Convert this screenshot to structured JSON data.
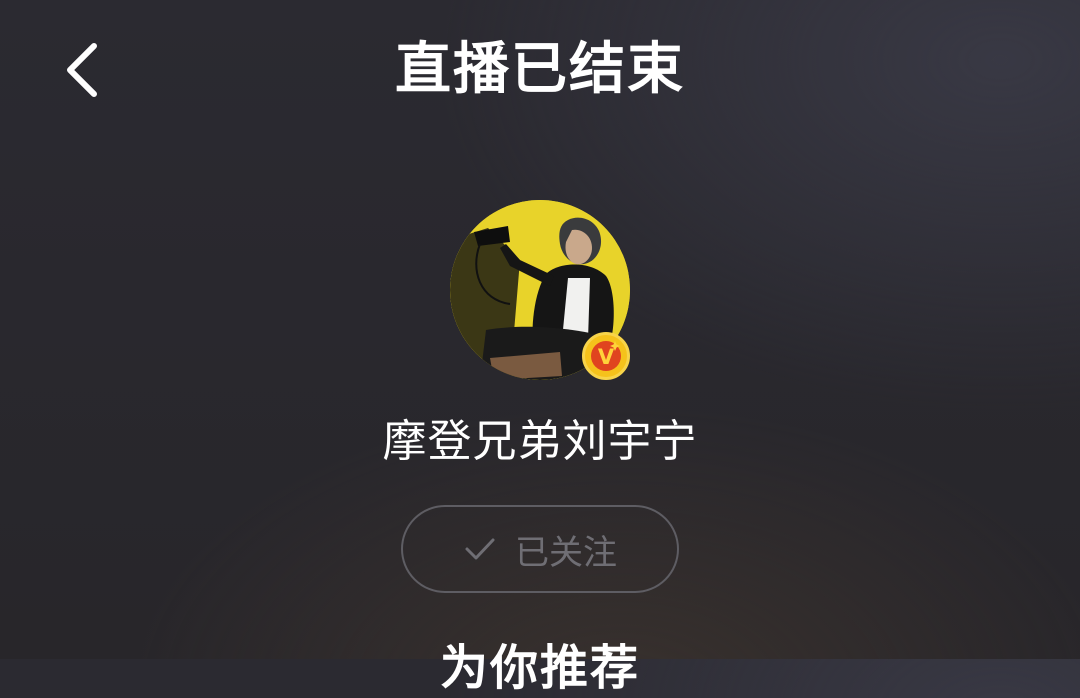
{
  "header": {
    "title": "直播已结束",
    "back_icon": "chevron-left-icon"
  },
  "streamer": {
    "name": "摩登兄弟刘宇宁",
    "avatar_icon": "avatar-photo",
    "badge_icon": "verified-v-icon",
    "badge_label": "V",
    "avatar_bg_color": "#e8d32a",
    "badge_color": "#f5c21b"
  },
  "follow": {
    "label": "已关注",
    "icon": "checkmark-icon"
  },
  "section": {
    "heading": "为你推荐"
  }
}
